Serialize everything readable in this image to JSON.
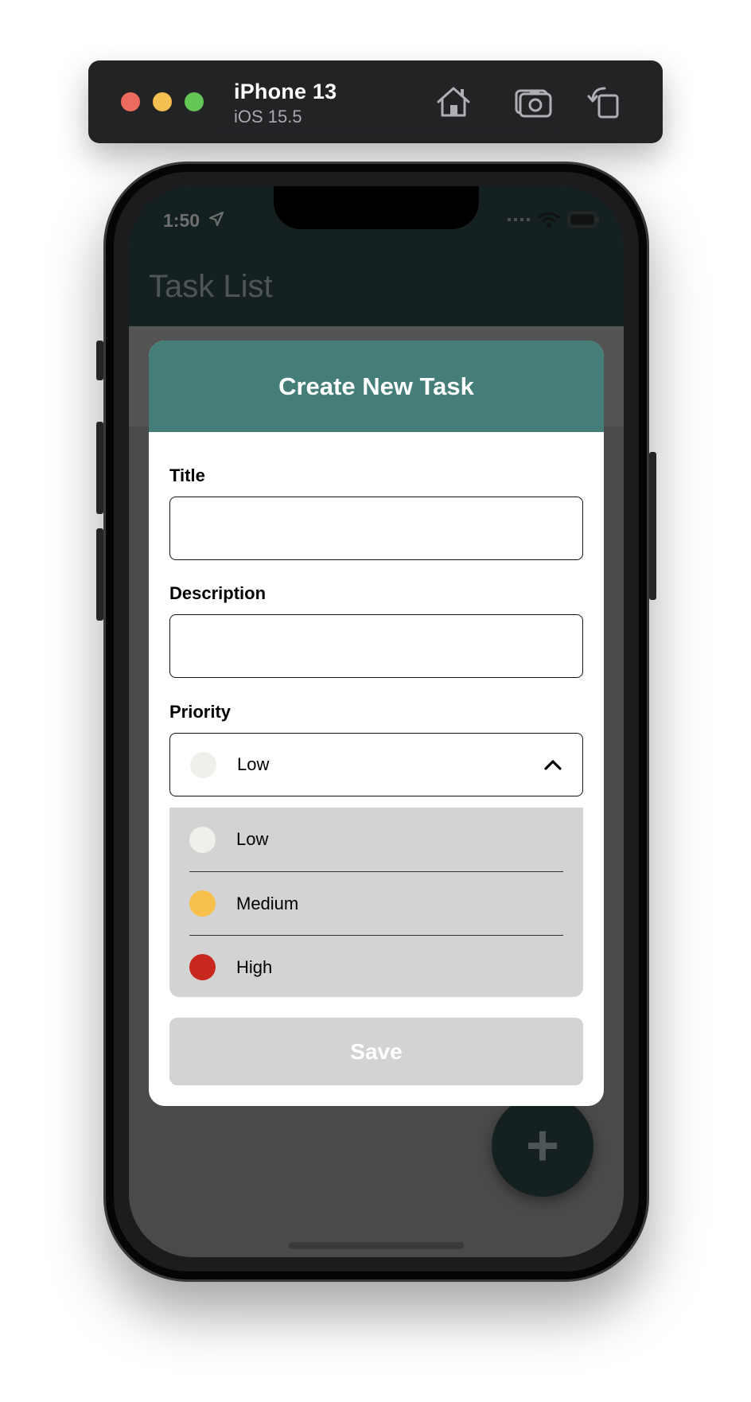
{
  "simulator": {
    "device_name": "iPhone 13",
    "os_version": "iOS 15.5",
    "colors": {
      "close": "#ed6a5e",
      "minimize": "#f5bf4f",
      "zoom": "#62c554"
    },
    "buttons": {
      "home_icon": "home-icon",
      "screenshot_icon": "camera-icon",
      "rotate_icon": "rotate-icon"
    }
  },
  "status_bar": {
    "time": "1:50"
  },
  "app": {
    "title": "Task List",
    "header_color": "#142120",
    "fab_label": "+"
  },
  "modal": {
    "title": "Create New Task",
    "header_color": "#457e79",
    "fields": {
      "title_label": "Title",
      "title_value": "",
      "description_label": "Description",
      "description_value": "",
      "priority_label": "Priority"
    },
    "priority": {
      "selected": "Low",
      "selected_color": "#f0efea",
      "options": [
        {
          "label": "Low",
          "color": "#f0efea"
        },
        {
          "label": "Medium",
          "color": "#f6c04a"
        },
        {
          "label": "High",
          "color": "#c8271d"
        }
      ]
    },
    "save_label": "Save"
  }
}
